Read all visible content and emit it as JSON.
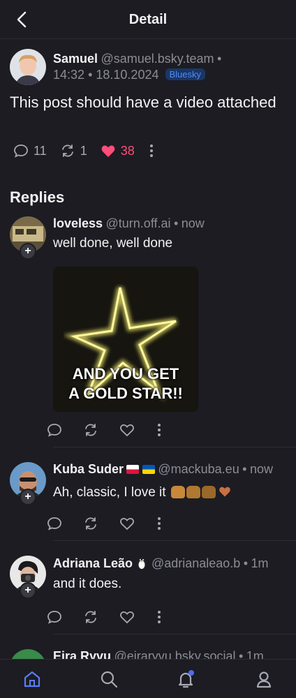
{
  "header": {
    "title": "Detail"
  },
  "post": {
    "name": "Samuel",
    "handle": "@samuel.bsky.team",
    "time": "14:32",
    "date": "18.10.2024",
    "badge": "Bluesky",
    "text": "This post should have a video attached",
    "replies": "11",
    "reposts": "1",
    "likes": "38"
  },
  "replies_heading": "Replies",
  "replies": [
    {
      "name": "loveless",
      "handle": "@turn.off.ai",
      "time": "now",
      "text": "well done, well done",
      "gif_caption_1": "AND YOU GET",
      "gif_caption_2": "A GOLD STAR!!"
    },
    {
      "name": "Kuba Suder",
      "handle": "@mackuba.eu",
      "time": "now",
      "text": "Ah, classic, I love it"
    },
    {
      "name": "Adriana Leão",
      "handle": "@adrianaleao.b",
      "time": "1m",
      "text": "and it does."
    },
    {
      "name": "Eira Ryvu",
      "handle": "@eiraryvu.bsky.social",
      "time": "1m",
      "text": ""
    }
  ],
  "tabs": [
    "home-icon",
    "search-icon",
    "bell-icon",
    "profile-icon"
  ],
  "colors": {
    "background": "#1c1c22",
    "like": "#ff4d79",
    "accent": "#4d6df5",
    "badge": "#4d8cf5"
  }
}
